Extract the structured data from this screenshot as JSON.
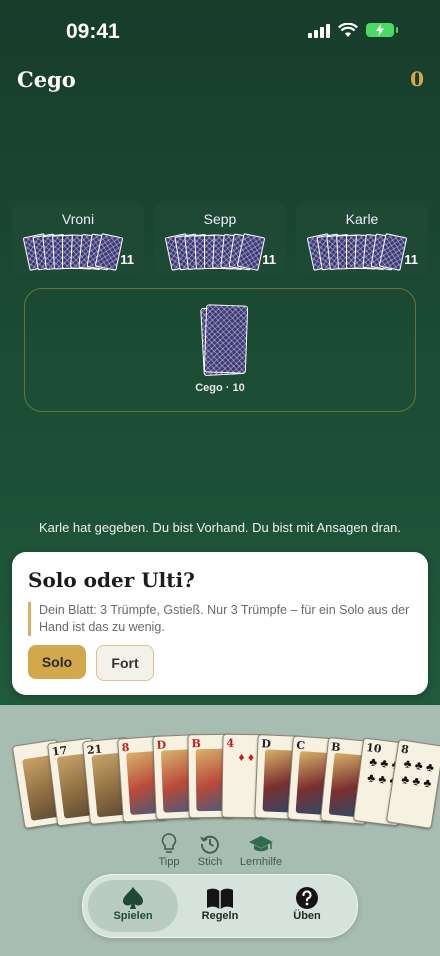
{
  "status": {
    "time": "09:41"
  },
  "header": {
    "title": "Cego",
    "score": "0"
  },
  "players": [
    {
      "name": "Vroni",
      "count": "11"
    },
    {
      "name": "Sepp",
      "count": "11"
    },
    {
      "name": "Karle",
      "count": "11"
    }
  ],
  "talon": {
    "label": "Cego · 10"
  },
  "message": "Karle hat gegeben. Du bist Vorhand. Du bist mit Ansagen dran.",
  "dialog": {
    "title": "Solo oder Ulti?",
    "text": "Dein Blatt: 3 Trümpfe, Gstieß. Nur 3 Trümpfe – für ein Solo aus der Hand ist das zu wenig.",
    "solo_label": "Solo",
    "fort_label": "Fort"
  },
  "hand": [
    {
      "index": "",
      "suit": "trump"
    },
    {
      "index": "17",
      "suit": "trump"
    },
    {
      "index": "21",
      "suit": "trump"
    },
    {
      "index": "8",
      "suit": "heart",
      "red": true
    },
    {
      "index": "D",
      "suit": "heart",
      "red": true
    },
    {
      "index": "B",
      "suit": "heart",
      "red": true
    },
    {
      "index": "4",
      "suit": "diamond",
      "red": true
    },
    {
      "index": "D",
      "suit": "club"
    },
    {
      "index": "C",
      "suit": "club"
    },
    {
      "index": "B",
      "suit": "club"
    },
    {
      "index": "10",
      "suit": "club"
    },
    {
      "index": "8",
      "suit": "club"
    }
  ],
  "tools": {
    "tip": "Tipp",
    "trick": "Stich",
    "learn": "Lernhilfe"
  },
  "tabs": {
    "play": "Spielen",
    "rules": "Regeln",
    "about": "Üben"
  },
  "colors": {
    "accent": "#d2a84b",
    "felt": "#1b4a33",
    "score": "#d4a947"
  }
}
